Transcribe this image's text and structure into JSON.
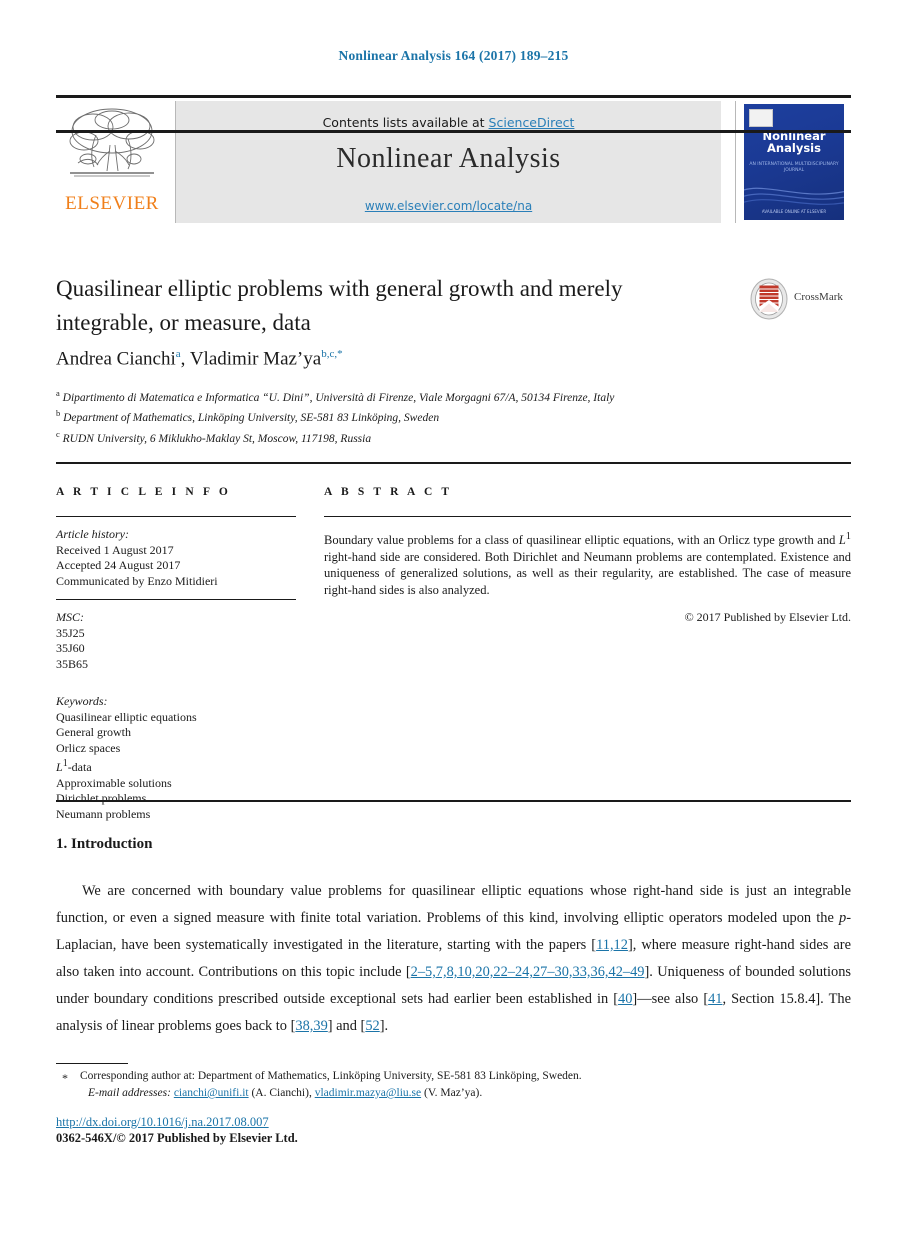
{
  "running_head": "Nonlinear Analysis 164 (2017) 189–215",
  "banner": {
    "contents_prefix": "Contents lists available at ",
    "sciencedirect": "ScienceDirect",
    "journal_name": "Nonlinear Analysis",
    "journal_url": "www.elsevier.com/locate/na",
    "publisher_logo_text": "ELSEVIER",
    "publisher_logo_icon": "elsevier-tree-icon",
    "cover": {
      "title_line1": "Nonlinear",
      "title_line2": "Analysis",
      "subtitle": "AN INTERNATIONAL\nMULTIDISCIPLINARY\nJOURNAL",
      "footer": "AVAILABLE ONLINE AT\nELSEVIER"
    }
  },
  "article": {
    "title_line1": "Quasilinear elliptic problems with general growth and merely",
    "title_line2": "integrable, or measure, data",
    "crossmark_label": "CrossMark",
    "crossmark_icon": "crossmark-icon",
    "authors": [
      {
        "name": "Andrea Cianchi",
        "marks": "a"
      },
      {
        "name": "Vladimir Maz’ya",
        "marks": "b,c,*"
      }
    ],
    "affiliations": [
      {
        "mark": "a",
        "text": "Dipartimento di Matematica e Informatica “U. Dini”, Università di Firenze, Viale Morgagni 67/A, 50134 Firenze, Italy"
      },
      {
        "mark": "b",
        "text": "Department of Mathematics, Linköping University, SE-581 83 Linköping, Sweden"
      },
      {
        "mark": "c",
        "text": "RUDN University, 6 Miklukho-Maklay St, Moscow, 117198, Russia"
      }
    ]
  },
  "article_info": {
    "heading": "A R T I C L E   I N F O",
    "history_label": "Article history:",
    "history": [
      "Received 1 August 2017",
      "Accepted 24 August 2017",
      "Communicated by Enzo Mitidieri"
    ],
    "msc_label": "MSC:",
    "msc": [
      "35J25",
      "35J60",
      "35B65"
    ],
    "keywords_label": "Keywords:",
    "keywords": [
      "Quasilinear elliptic equations",
      "General growth",
      "Orlicz spaces",
      "L1-data",
      "Approximable solutions",
      "Dirichlet problems",
      "Neumann problems"
    ]
  },
  "abstract": {
    "heading": "A B S T R A C T",
    "text": "Boundary value problems for a class of quasilinear elliptic equations, with an Orlicz type growth and L1 right-hand side are considered. Both Dirichlet and Neumann problems are contemplated. Existence and uniqueness of generalized solutions, as well as their regularity, are established. The case of measure right-hand sides is also analyzed.",
    "copyright": "© 2017 Published by Elsevier Ltd."
  },
  "introduction": {
    "heading": "1. Introduction",
    "paragraph": "We are concerned with boundary value problems for quasilinear elliptic equations whose right-hand side is just an integrable function, or even a signed measure with finite total variation. Problems of this kind, involving elliptic operators modeled upon the p-Laplacian, have been systematically investigated in the literature, starting with the papers [11,12], where measure right-hand sides are also taken into account. Contributions on this topic include [2–5,7,8,10,20,22–24,27–30,33,36,42–49]. Uniqueness of bounded solutions under boundary conditions prescribed outside exceptional sets had earlier been established in [40]—see also [41, Section 15.8.4]. The analysis of linear problems goes back to [38,39] and [52].",
    "citations": [
      "11,12",
      "2–5,7,8,10,20,22–24,27–30,33,36,42–49",
      "40",
      "41",
      "38,39",
      "52"
    ]
  },
  "footer": {
    "star": "*",
    "corresponding": "Corresponding author at: Department of Mathematics, Linköping University, SE-581 83 Linköping, Sweden.",
    "email_label": "E-mail addresses:",
    "email1": "cianchi@unifi.it",
    "email1_owner": "(A. Cianchi),",
    "email2": "vladimir.mazya@liu.se",
    "email2_owner": "(V. Maz’ya).",
    "doi": "http://dx.doi.org/10.1016/j.na.2017.08.007",
    "issn_line": "0362-546X/© 2017 Published by Elsevier Ltd."
  },
  "colors": {
    "link_blue": "#1b74a8",
    "elsevier_orange": "#f07f1a",
    "banner_grey": "#e6e6e6",
    "cover_blue": "#1d3f9e",
    "crossmark_red": "#c0392b"
  }
}
